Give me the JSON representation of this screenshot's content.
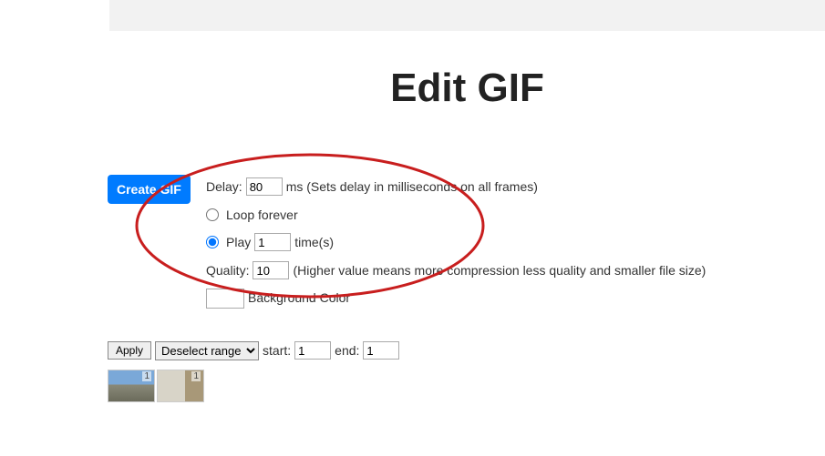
{
  "title": "Edit GIF",
  "createButton": "Create GIF",
  "delay": {
    "label": "Delay:",
    "value": "80",
    "unitHint": "ms (Sets delay in milliseconds on all frames)"
  },
  "loop": {
    "foreverLabel": "Loop forever",
    "playPrefix": "Play",
    "playValue": "1",
    "playSuffix": "time(s)",
    "selected": "play"
  },
  "quality": {
    "label": "Quality:",
    "value": "10",
    "hint": "(Higher value means more compression less quality and smaller file size)"
  },
  "bgcolor": {
    "label": "Background Color"
  },
  "range": {
    "apply": "Apply",
    "selectValue": "Deselect range",
    "startLabel": "start:",
    "startValue": "1",
    "endLabel": "end:",
    "endValue": "1"
  },
  "thumbLabels": [
    "1",
    "1"
  ]
}
